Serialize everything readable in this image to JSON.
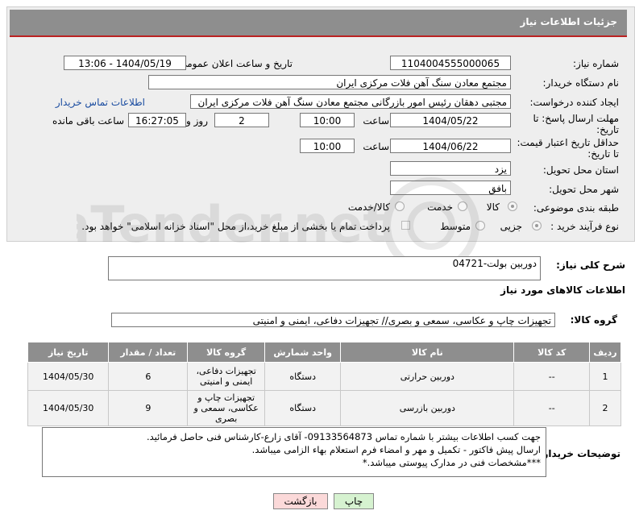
{
  "header": {
    "title": "جزئیات اطلاعات نیاز"
  },
  "fields": {
    "need_number_label": "شماره نیاز:",
    "need_number": "1104004555000065",
    "announce_label": "تاریخ و ساعت اعلان عمومی:",
    "announce_value": "1404/05/19 - 13:06",
    "buyer_label": "نام دستگاه خریدار:",
    "buyer_value": "مجتمع معادن سنگ آهن فلات مرکزی ایران",
    "creator_label": "ایجاد کننده درخواست:",
    "creator_value": "مجتبی  دهقان رئیس امور بازرگانی مجتمع معادن سنگ آهن فلات مرکزی ایران",
    "contact_link": "اطلاعات تماس خریدار",
    "deadline_label_1": "مهلت ارسال پاسخ: تا",
    "deadline_label_2": "تاریخ:",
    "deadline_date": "1404/05/22",
    "time_label": "ساعت",
    "deadline_time": "10:00",
    "days_value": "2",
    "days_label": "روز و",
    "remaining_time": "16:27:05",
    "remaining_label": "ساعت باقی مانده",
    "validity_label_1": "حداقل تاریخ اعتبار قیمت:",
    "validity_label_2": "تا تاریخ:",
    "validity_date": "1404/06/22",
    "validity_time": "10:00",
    "province_label": "استان محل تحویل:",
    "province_value": "یزد",
    "city_label": "شهر محل تحویل:",
    "city_value": "بافق",
    "category_label": "طبقه بندی موضوعی:",
    "category_options": [
      "کالا",
      "خدمت",
      "کالا/خدمت"
    ],
    "process_label": "نوع فرآیند خرید :",
    "process_options": [
      "جزیی",
      "متوسط"
    ],
    "payment_note": "پرداخت تمام یا بخشی از مبلغ خرید،از محل \"اسناد خزانه اسلامی\" خواهد بود.",
    "summary_label": "شرح کلی نیاز:",
    "summary_value": "دوربین بولت-04721",
    "goods_info_title": "اطلاعات کالاهای مورد نیاز",
    "goods_group_label": "گروه کالا:",
    "goods_group_value": "تجهیزات چاپ و عکاسی، سمعی و بصری// تجهیزات دفاعی، ایمنی و امنیتی",
    "buyer_notes_label": "توضیحات خریدار:",
    "buyer_notes_lines": [
      "جهت کسب اطلاعات بیشتر با شماره تماس 09133564873- آقای زارع-کارشناس فنی حاصل فرمائید.",
      "ارسال پیش فاکتور - تکمیل و مهر و امضاء فرم استعلام بهاء الزامی میباشد.",
      "***مشخصات فنی در مدارک پیوستی میباشد.*"
    ]
  },
  "table": {
    "headers": [
      "ردیف",
      "کد کالا",
      "نام کالا",
      "واحد شمارش",
      "گروه کالا",
      "تعداد / مقدار",
      "تاریخ نیاز"
    ],
    "rows": [
      [
        "1",
        "--",
        "دوربین حرارتی",
        "دستگاه",
        "تجهیزات دفاعی، ایمنی و امنیتی",
        "6",
        "1404/05/30"
      ],
      [
        "2",
        "--",
        "دوربین بازرسی",
        "دستگاه",
        "تجهیزات چاپ و عکاسی، سمعی و بصری",
        "9",
        "1404/05/30"
      ]
    ]
  },
  "buttons": {
    "print": "چاپ",
    "back": "بازگشت"
  },
  "watermark": {
    "text": "AriaTender.net"
  },
  "colors": {
    "header_bg": "#8e8e8e",
    "panel_bg": "#eeeeee",
    "link": "#1a4ca0",
    "back_btn_bg": "#fbd9d9",
    "print_btn_bg": "#d6f2d0"
  }
}
